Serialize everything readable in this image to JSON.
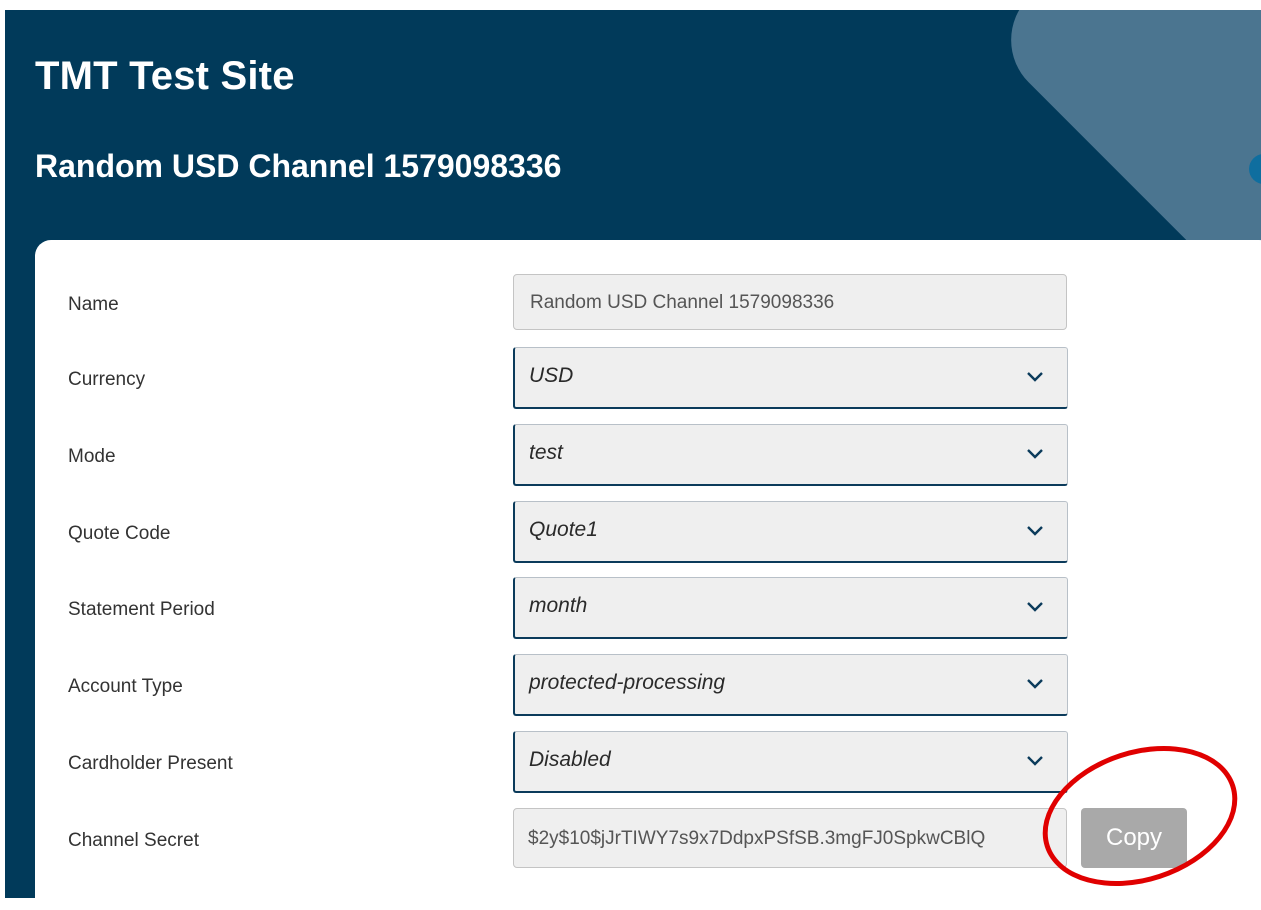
{
  "header": {
    "site_title": "TMT Test Site",
    "channel_title": "Random USD Channel 1579098336"
  },
  "form": {
    "name": {
      "label": "Name",
      "value": "Random USD Channel 1579098336"
    },
    "currency": {
      "label": "Currency",
      "value": "USD"
    },
    "mode": {
      "label": "Mode",
      "value": "test"
    },
    "quote_code": {
      "label": "Quote Code",
      "value": "Quote1"
    },
    "statement_period": {
      "label": "Statement Period",
      "value": "month"
    },
    "account_type": {
      "label": "Account Type",
      "value": "protected-processing"
    },
    "cardholder_present": {
      "label": "Cardholder Present",
      "value": "Disabled"
    },
    "channel_secret": {
      "label": "Channel Secret",
      "value": "$2y$10$jJrTIWY7s9x7DdpxPSfSB.3mgFJ0SpkwCBlQ",
      "copy_label": "Copy"
    }
  },
  "icons": {
    "select_arrow": "chevron-down-icon"
  },
  "colors": {
    "header_bg": "#013a5a",
    "decor_shape": "#4b7590",
    "copy_button_bg": "#a9a9a9",
    "annotation_circle": "#e00000"
  }
}
